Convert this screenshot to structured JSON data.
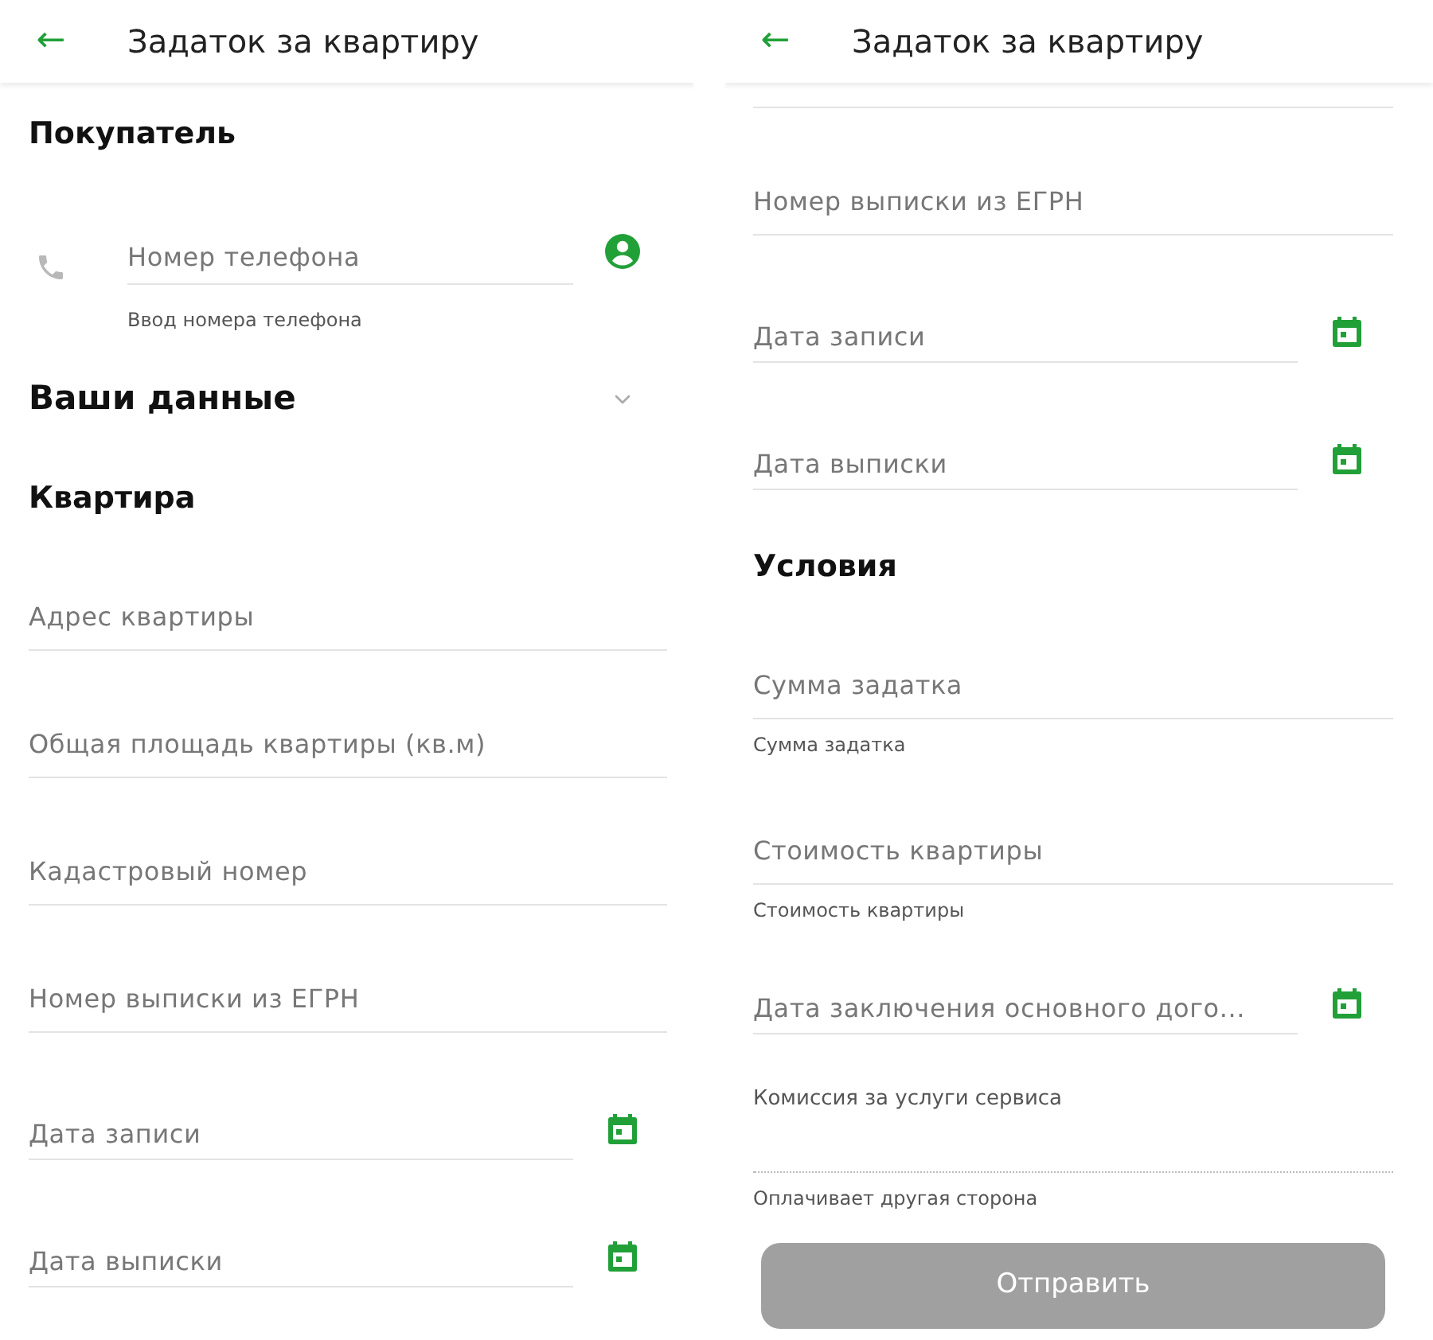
{
  "screens": [
    {
      "header": {
        "back": "←",
        "title": "Задаток за квартиру"
      },
      "items": [
        {
          "kind": "section",
          "text": "Покупатель"
        },
        {
          "kind": "phone",
          "placeholder": "Номер телефона"
        },
        {
          "kind": "helper",
          "text": "Ввод номера телефона"
        },
        {
          "kind": "expandable",
          "text": "Ваши данные",
          "expanded": false
        },
        {
          "kind": "section",
          "text": "Квартира"
        },
        {
          "kind": "field",
          "placeholder": "Адрес квартиры"
        },
        {
          "kind": "field",
          "placeholder": "Общая площадь квартиры (кв.м)"
        },
        {
          "kind": "field",
          "placeholder": "Кадастровый номер"
        },
        {
          "kind": "field",
          "placeholder": "Номер выписки из ЕГРН"
        },
        {
          "kind": "date",
          "placeholder": "Дата записи"
        },
        {
          "kind": "date",
          "placeholder": "Дата выписки"
        }
      ]
    },
    {
      "header": {
        "back": "←",
        "title": "Задаток за квартиру"
      },
      "items": [
        {
          "kind": "cut"
        },
        {
          "kind": "field",
          "placeholder": "Номер выписки из ЕГРН"
        },
        {
          "kind": "date",
          "placeholder": "Дата записи"
        },
        {
          "kind": "date",
          "placeholder": "Дата выписки"
        },
        {
          "kind": "section",
          "text": "Условия"
        },
        {
          "kind": "field",
          "placeholder": "Сумма задатка"
        },
        {
          "kind": "helper",
          "text": "Сумма задатка"
        },
        {
          "kind": "field",
          "placeholder": "Стоимость квартиры"
        },
        {
          "kind": "helper",
          "text": "Стоимость квартиры"
        },
        {
          "kind": "date",
          "placeholder": "Дата заключения основного дого..."
        },
        {
          "kind": "label",
          "text": "Комиссия за услуги сервиса"
        },
        {
          "kind": "dotted"
        },
        {
          "kind": "helper",
          "text": "Оплачивает другая сторона"
        },
        {
          "kind": "button",
          "text": "Отправить",
          "disabled": true
        }
      ]
    }
  ]
}
